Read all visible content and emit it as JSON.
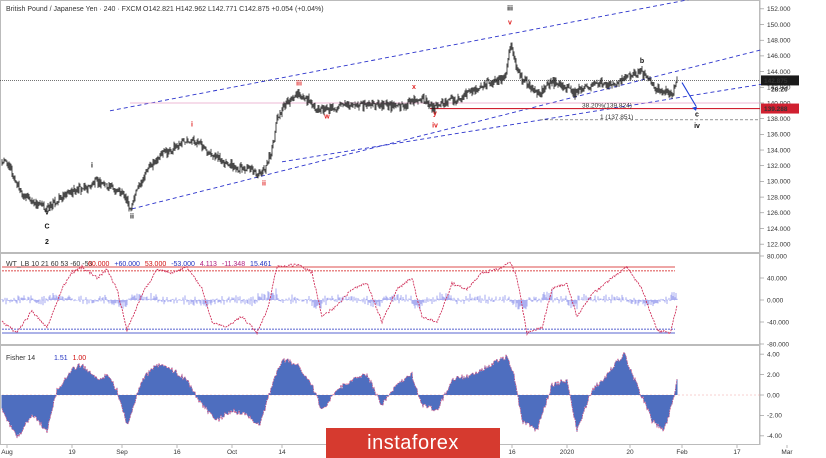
{
  "header": {
    "symbol_line": "British Pound / Japanese Yen · 240 · FXCM",
    "ohlc": "O142.821 H142.962 L142.771 C142.875 +0.054 (+0.04%)"
  },
  "colors": {
    "candle": "#1a1a1a",
    "channel": "#2b33cc",
    "wave_red": "#e02020",
    "wave_black": "#111111",
    "wt_line": "#d0305a",
    "wt_fill": "#9aa0ee",
    "fisher_bar": "#3a5fb8"
  },
  "chart_data": [
    {
      "type": "candlestick",
      "panel": "price",
      "y_axis": {
        "range": [
          121,
          153
        ],
        "ticks": [
          "152.000",
          "150.000",
          "148.000",
          "146.000",
          "144.000",
          "142.000",
          "140.000",
          "138.000",
          "136.000",
          "134.000",
          "132.000",
          "130.000",
          "128.000",
          "126.000",
          "124.000",
          "122.000"
        ]
      },
      "x_axis": {
        "labels": [
          "Aug",
          "19",
          "Sep",
          "16",
          "Oct",
          "14",
          "Nov",
          "18",
          "16",
          "2020",
          "20",
          "Feb",
          "17",
          "Mar"
        ],
        "label_bars": [
          5,
          70,
          120,
          175,
          230,
          280,
          330,
          390,
          510,
          565,
          628,
          680,
          735,
          785
        ]
      },
      "close_path": [
        [
          5,
          132.5
        ],
        [
          12,
          130.5
        ],
        [
          20,
          128.5
        ],
        [
          30,
          127.5
        ],
        [
          45,
          126.5
        ],
        [
          55,
          127.5
        ],
        [
          70,
          128.8
        ],
        [
          85,
          129.2
        ],
        [
          95,
          130.0
        ],
        [
          105,
          129.5
        ],
        [
          115,
          129.0
        ],
        [
          122,
          128.2
        ],
        [
          128,
          126.5
        ],
        [
          135,
          129.0
        ],
        [
          145,
          131.5
        ],
        [
          160,
          133.5
        ],
        [
          175,
          134.5
        ],
        [
          185,
          135.5
        ],
        [
          195,
          135.0
        ],
        [
          210,
          133.5
        ],
        [
          230,
          132.0
        ],
        [
          245,
          131.5
        ],
        [
          258,
          131.0
        ],
        [
          262,
          131.5
        ],
        [
          270,
          134.0
        ],
        [
          275,
          138.0
        ],
        [
          285,
          140.0
        ],
        [
          295,
          141.0
        ],
        [
          305,
          140.5
        ],
        [
          318,
          139.0
        ],
        [
          325,
          139.3
        ],
        [
          340,
          139.5
        ],
        [
          360,
          139.8
        ],
        [
          380,
          139.8
        ],
        [
          395,
          139.5
        ],
        [
          410,
          140.0
        ],
        [
          420,
          140.8
        ],
        [
          428,
          139.5
        ],
        [
          432,
          139.2
        ],
        [
          440,
          140.0
        ],
        [
          455,
          140.5
        ],
        [
          470,
          141.5
        ],
        [
          485,
          142.5
        ],
        [
          495,
          142.8
        ],
        [
          503,
          143.5
        ],
        [
          508,
          147.5
        ],
        [
          515,
          144.5
        ],
        [
          520,
          143.0
        ],
        [
          530,
          142.0
        ],
        [
          538,
          141.0
        ],
        [
          545,
          142.5
        ],
        [
          555,
          142.5
        ],
        [
          565,
          142.0
        ],
        [
          572,
          141.2
        ],
        [
          580,
          142.0
        ],
        [
          595,
          142.5
        ],
        [
          610,
          142.5
        ],
        [
          620,
          143.0
        ],
        [
          630,
          143.5
        ],
        [
          638,
          144.0
        ],
        [
          645,
          143.5
        ],
        [
          652,
          142.0
        ],
        [
          660,
          141.5
        ],
        [
          670,
          141.2
        ],
        [
          675,
          142.875
        ]
      ],
      "last_price": "142.875",
      "countdown": "28:26",
      "retracement_label": "38.20%(139.824)",
      "retracement_price": "139.288",
      "target_label": "1 (137.851)",
      "wave_labels": [
        {
          "text": "v",
          "color": "black",
          "bar": 45,
          "price": 125.8
        },
        {
          "text": "C",
          "color": "black",
          "bar": 45,
          "price": 124.0
        },
        {
          "text": "2",
          "color": "black",
          "bar": 45,
          "price": 122.0
        },
        {
          "text": "i",
          "color": "black",
          "bar": 90,
          "price": 131.8
        },
        {
          "text": "ii",
          "color": "black",
          "bar": 130,
          "price": 125.3
        },
        {
          "text": "i",
          "color": "red",
          "bar": 190,
          "price": 137.0
        },
        {
          "text": "ii",
          "color": "red",
          "bar": 262,
          "price": 129.5
        },
        {
          "text": "iii",
          "color": "red",
          "bar": 297,
          "price": 142.2
        },
        {
          "text": "w",
          "color": "red",
          "bar": 325,
          "price": 138.0
        },
        {
          "text": "x",
          "color": "red",
          "bar": 412,
          "price": 141.8
        },
        {
          "text": "y",
          "color": "red",
          "bar": 433,
          "price": 138.4
        },
        {
          "text": "iv",
          "color": "red",
          "bar": 433,
          "price": 136.9
        },
        {
          "text": "iii",
          "color": "black",
          "bar": 508,
          "price": 151.8
        },
        {
          "text": "v",
          "color": "red",
          "bar": 508,
          "price": 150.0
        },
        {
          "text": "b",
          "color": "black",
          "bar": 640,
          "price": 145.1
        },
        {
          "text": "c",
          "color": "black",
          "bar": 695,
          "price": 138.3
        },
        {
          "text": "iv",
          "color": "black",
          "bar": 695,
          "price": 136.8
        }
      ]
    },
    {
      "type": "line",
      "panel": "oscillator",
      "title": "WT_LB 10 21 60 53 -60 -53",
      "legend_values": [
        "60.000",
        "+60.000",
        "53.000",
        "-53.000",
        "4.113",
        "-11.348",
        "15.461"
      ],
      "y_axis": {
        "range": [
          -80,
          80
        ],
        "ticks": [
          "80.000",
          "40.000",
          "0.000",
          "-40.000",
          "-80.000"
        ]
      },
      "levels": [
        60,
        53,
        -53,
        -60
      ],
      "wt1_path": [
        [
          0,
          -40
        ],
        [
          15,
          -60
        ],
        [
          30,
          -20
        ],
        [
          45,
          -50
        ],
        [
          60,
          20
        ],
        [
          70,
          50
        ],
        [
          80,
          60
        ],
        [
          95,
          40
        ],
        [
          105,
          55
        ],
        [
          115,
          20
        ],
        [
          125,
          -55
        ],
        [
          140,
          10
        ],
        [
          155,
          55
        ],
        [
          170,
          50
        ],
        [
          185,
          60
        ],
        [
          200,
          20
        ],
        [
          210,
          -40
        ],
        [
          225,
          -50
        ],
        [
          240,
          -30
        ],
        [
          255,
          -60
        ],
        [
          265,
          -20
        ],
        [
          275,
          60
        ],
        [
          295,
          65
        ],
        [
          310,
          50
        ],
        [
          320,
          -30
        ],
        [
          335,
          -10
        ],
        [
          350,
          20
        ],
        [
          365,
          30
        ],
        [
          380,
          -40
        ],
        [
          395,
          20
        ],
        [
          410,
          40
        ],
        [
          420,
          -30
        ],
        [
          435,
          -40
        ],
        [
          450,
          30
        ],
        [
          465,
          20
        ],
        [
          480,
          50
        ],
        [
          495,
          55
        ],
        [
          508,
          70
        ],
        [
          515,
          40
        ],
        [
          525,
          -60
        ],
        [
          540,
          -50
        ],
        [
          550,
          20
        ],
        [
          565,
          30
        ],
        [
          575,
          -30
        ],
        [
          590,
          10
        ],
        [
          610,
          40
        ],
        [
          625,
          60
        ],
        [
          640,
          20
        ],
        [
          655,
          -55
        ],
        [
          668,
          -60
        ],
        [
          675,
          -11.348
        ]
      ],
      "histogram_scale": 0.35
    },
    {
      "type": "bar",
      "panel": "fisher",
      "title": "Fisher 14",
      "legend_values": [
        "1.51",
        "1.00"
      ],
      "y_axis": {
        "range": [
          -4.6,
          4.6
        ],
        "ticks": [
          "4.00",
          "2.00",
          "0.00",
          "-2.00",
          "-4.00"
        ]
      },
      "values_path": [
        [
          0,
          -1.5
        ],
        [
          15,
          -4.2
        ],
        [
          30,
          -2.0
        ],
        [
          45,
          -3.5
        ],
        [
          55,
          0.5
        ],
        [
          70,
          2.5
        ],
        [
          80,
          3.0
        ],
        [
          95,
          1.5
        ],
        [
          105,
          2.0
        ],
        [
          115,
          0.5
        ],
        [
          125,
          -3.0
        ],
        [
          140,
          1.5
        ],
        [
          155,
          3.0
        ],
        [
          170,
          2.5
        ],
        [
          185,
          1.5
        ],
        [
          200,
          -1.0
        ],
        [
          215,
          -2.5
        ],
        [
          230,
          -1.5
        ],
        [
          245,
          -2.0
        ],
        [
          258,
          -3.0
        ],
        [
          270,
          1.0
        ],
        [
          280,
          3.5
        ],
        [
          295,
          3.0
        ],
        [
          310,
          1.0
        ],
        [
          320,
          -1.5
        ],
        [
          335,
          0.5
        ],
        [
          350,
          1.5
        ],
        [
          365,
          2.0
        ],
        [
          380,
          -1.0
        ],
        [
          395,
          1.0
        ],
        [
          410,
          2.0
        ],
        [
          420,
          -1.0
        ],
        [
          435,
          -1.5
        ],
        [
          450,
          1.5
        ],
        [
          470,
          2.0
        ],
        [
          490,
          3.0
        ],
        [
          505,
          3.8
        ],
        [
          512,
          2.0
        ],
        [
          520,
          -2.5
        ],
        [
          535,
          -3.5
        ],
        [
          550,
          1.0
        ],
        [
          565,
          1.5
        ],
        [
          575,
          -3.5
        ],
        [
          590,
          0.5
        ],
        [
          605,
          2.0
        ],
        [
          622,
          4.1
        ],
        [
          635,
          1.0
        ],
        [
          650,
          -2.5
        ],
        [
          662,
          -3.5
        ],
        [
          670,
          -1.0
        ],
        [
          675,
          1.51
        ]
      ]
    }
  ],
  "watermark": "instaforex"
}
